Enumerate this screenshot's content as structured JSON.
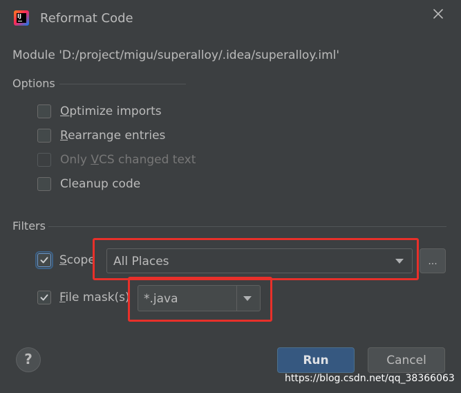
{
  "window": {
    "title": "Reformat Code"
  },
  "module_line": "Module 'D:/project/migu/superalloy/.idea/superalloy.iml'",
  "options": {
    "label": "Options",
    "optimize_imports": {
      "prefix": "",
      "mnemonic": "O",
      "rest": "ptimize imports",
      "checked": false
    },
    "rearrange_entries": {
      "prefix": "",
      "mnemonic": "R",
      "rest": "earrange entries",
      "checked": false
    },
    "only_vcs": {
      "prefix": "Only ",
      "mnemonic": "V",
      "rest": "CS changed text",
      "checked": false,
      "disabled": true
    },
    "cleanup_code": {
      "prefix": "Cleanup code",
      "checked": false
    }
  },
  "filters": {
    "label": "Filters",
    "scope": {
      "prefix": "",
      "mnemonic": "S",
      "rest": "cope",
      "checked": true,
      "value": "All Places",
      "browse_label": "..."
    },
    "file_mask": {
      "prefix": "",
      "mnemonic": "F",
      "rest": "ile mask(s)",
      "checked": true,
      "value": "*.java"
    }
  },
  "buttons": {
    "help": "?",
    "run": "Run",
    "cancel": "Cancel"
  },
  "watermark": "https://blog.csdn.net/qq_38366063",
  "colors": {
    "accent": "#365880",
    "highlight": "#e8302a",
    "background": "#3c3f41"
  }
}
